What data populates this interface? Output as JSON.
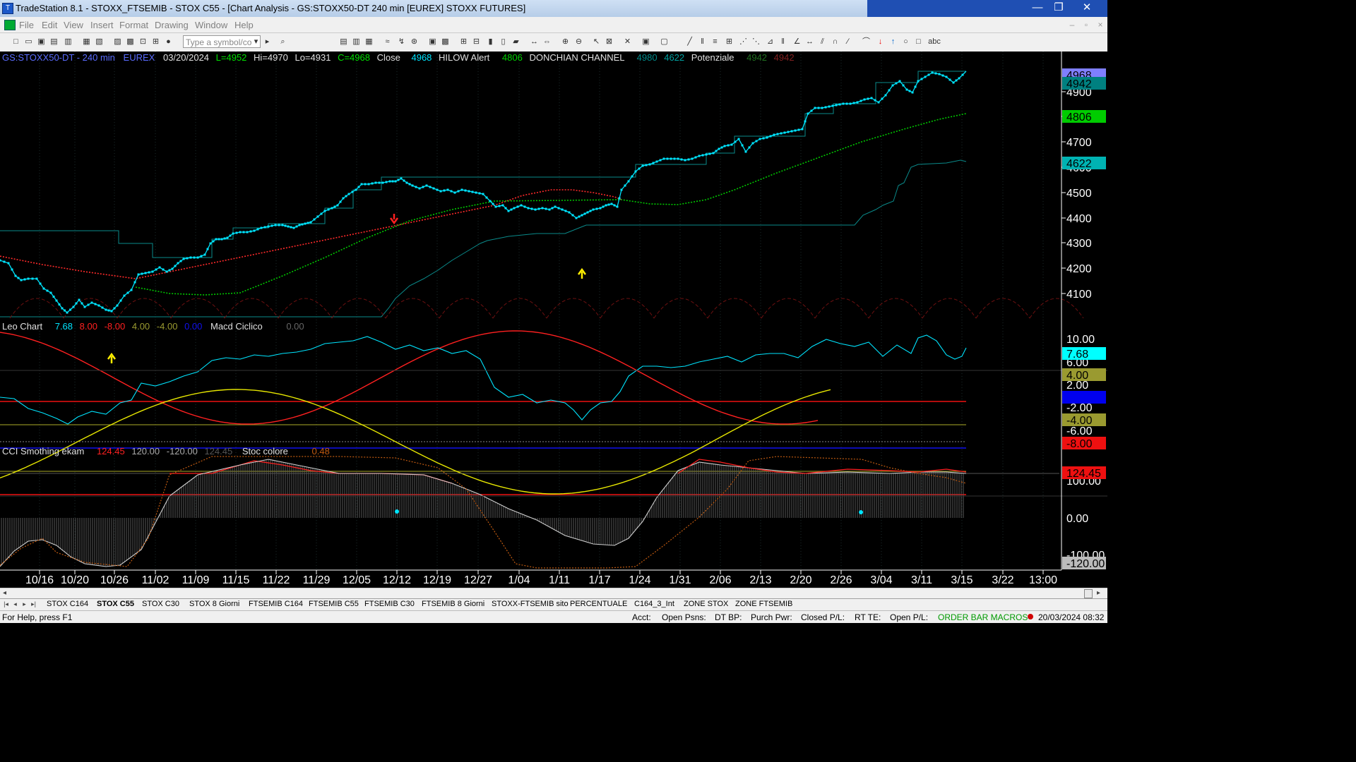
{
  "window": {
    "title": "TradeStation 8.1 - STOXX_FTSEMIB - STOX C55 - [Chart Analysis - GS:STOXX50-DT  240 min  [EUREX] STOXX FUTURES]",
    "minimize": "—",
    "restore": "❐",
    "close": "✕"
  },
  "menu": [
    "File",
    "Edit",
    "View",
    "Insert",
    "Format",
    "Drawing",
    "Window",
    "Help"
  ],
  "mdi": {
    "minimize": "–",
    "restore": "▫",
    "close": "×"
  },
  "toolbar": {
    "symbol_placeholder": "Type a symbol/co"
  },
  "price_header": {
    "symbol": "GS:STOXX50-DT - 240 min",
    "exchange": "EUREX",
    "date": "03/20/2024",
    "low_label": "L=4952",
    "hi": "Hi=4970",
    "lo": "Lo=4931",
    "close_val": "C=4968",
    "close_name": "Close",
    "close_num": "4968",
    "hilow_name": "HILOW Alert",
    "hilow_num": "4806",
    "donchian_name": "DONCHIAN CHANNEL",
    "don_hi": "4980",
    "don_lo": "4622",
    "pot_name": "Potenziale",
    "pot_a": "4942",
    "pot_b": "4942"
  },
  "price_axis": [
    "4900",
    "4800",
    "4700",
    "4600",
    "4500",
    "4400",
    "4300",
    "4200",
    "4100"
  ],
  "price_badges": [
    {
      "text": "4968",
      "bg": "#7f7fff",
      "fg": "#000000"
    },
    {
      "text": "4942",
      "bg": "#008080",
      "fg": "#000000"
    },
    {
      "text": "4806",
      "bg": "#00cc00",
      "fg": "#000000"
    },
    {
      "text": "4622",
      "bg": "#00b3b3",
      "fg": "#000000"
    }
  ],
  "macd_header": {
    "name": "Leo Chart",
    "v1": "7.68",
    "v2": "8.00",
    "v3": "-8.00",
    "v4": "4.00",
    "v5": "-4.00",
    "v6": "0.00",
    "name2": "Macd Ciclico",
    "v7": "0.00"
  },
  "macd_axis": [
    "10.00",
    "6.00",
    "2.00",
    "-2.00",
    "-6.00"
  ],
  "macd_badges": [
    {
      "text": "7.68",
      "bg": "#00ffff",
      "fg": "#000000"
    },
    {
      "text": "4.00",
      "bg": "#9a9a30",
      "fg": "#000000"
    },
    {
      "text": "0.00",
      "bg": "#0000ee",
      "fg": "#0000ee"
    },
    {
      "text": "-4.00",
      "bg": "#9a9a30",
      "fg": "#000000"
    },
    {
      "text": "-8.00",
      "bg": "#ee1010",
      "fg": "#000000"
    }
  ],
  "cci_header": {
    "name": "CCI Smothing ekam",
    "v1": "124.45",
    "v2": "120.00",
    "v3": "-120.00",
    "v4": "124.45",
    "name2": "Stoc colore",
    "v5": "0.48"
  },
  "cci_axis": [
    "100.00",
    "0.00",
    "-100.00"
  ],
  "cci_badges": [
    {
      "text": "124.45",
      "bg": "#ee1010",
      "fg": "#000000"
    },
    {
      "text": "-120.00",
      "bg": "#bbbbbb",
      "fg": "#000000"
    }
  ],
  "time_axis": [
    "10/16",
    "10/20",
    "10/26",
    "11/02",
    "11/09",
    "11/15",
    "11/22",
    "11/29",
    "12/05",
    "12/12",
    "12/19",
    "12/27",
    "1/04",
    "1/11",
    "1/17",
    "1/24",
    "1/31",
    "2/06",
    "2/13",
    "2/20",
    "2/26",
    "3/04",
    "3/11",
    "3/15",
    "3/22",
    "13:00"
  ],
  "tabs": [
    "STOX C164",
    "STOX C55",
    "STOX  C30",
    "STOX  8 Giorni",
    "FTSEMIB C164",
    "FTSEMIB C55",
    "FTSEMIB C30",
    "FTSEMIB  8 Giorni",
    "STOXX-FTSEMIB sito",
    "PERCENTUALE",
    "C164_3_Int",
    "ZONE STOX",
    "ZONE FTSEMIB"
  ],
  "active_tab": "STOX C55",
  "status": {
    "help": "For Help, press F1",
    "acct": "Acct:",
    "open_psns": "Open Psns:",
    "dt_bp": "DT BP:",
    "purch_pwr": "Purch Pwr:",
    "closed_pl": "Closed P/L:",
    "rt_te": "RT TE:",
    "open_pl": "Open P/L:",
    "macros": "ORDER BAR  MACROS",
    "datetime": "20/03/2024 08:32"
  },
  "colors": {
    "price": "#00e5ff",
    "donchian": "#0a8a8a",
    "hilow": "#00c800",
    "macd_red": "#ff2020",
    "macd_yellow": "#e6e600",
    "cci_gray": "#cfcfcf",
    "cci_red": "#ff2020",
    "stoc_orange": "#c05a10"
  }
}
